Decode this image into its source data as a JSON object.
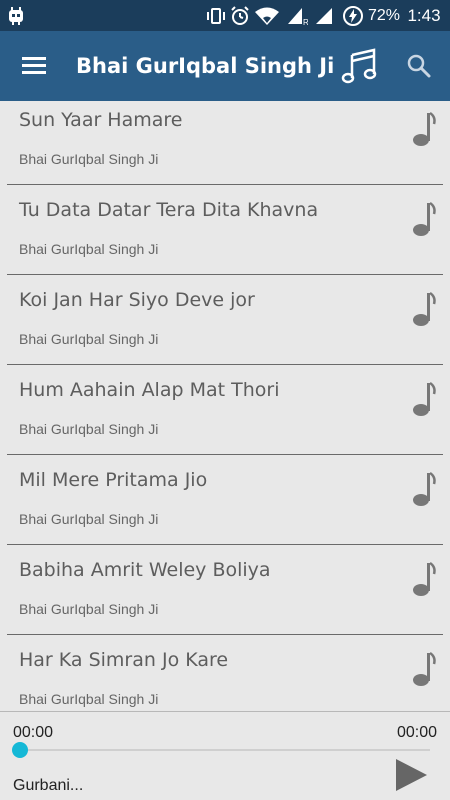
{
  "status_bar": {
    "battery": "72%",
    "time": "1:43",
    "icons": [
      "android-debug-icon",
      "vibrate-icon",
      "alarm-icon",
      "wifi-icon",
      "signal-r-icon",
      "signal-icon",
      "battery-charging-icon"
    ]
  },
  "app_bar": {
    "title": "Bhai GurIqbal Singh Ji",
    "menu_icon": "hamburger-menu-icon",
    "music_icon": "music-notes-icon",
    "search_icon": "search-icon",
    "color": "#2a5d88"
  },
  "songs": [
    {
      "title": "Sun Yaar Hamare",
      "artist": "Bhai GurIqbal Singh Ji"
    },
    {
      "title": "Tu Data Datar Tera Dita Khavna",
      "artist": "Bhai GurIqbal Singh Ji"
    },
    {
      "title": "Koi Jan Har Siyo Deve jor",
      "artist": "Bhai GurIqbal Singh Ji"
    },
    {
      "title": "Hum Aahain Alap Mat Thori",
      "artist": "Bhai GurIqbal Singh Ji"
    },
    {
      "title": "Mil Mere Pritama Jio",
      "artist": "Bhai GurIqbal Singh Ji"
    },
    {
      "title": "Babiha Amrit Weley Boliya",
      "artist": "Bhai GurIqbal Singh Ji"
    },
    {
      "title": "Har Ka Simran Jo Kare",
      "artist": "Bhai GurIqbal Singh Ji"
    }
  ],
  "player": {
    "elapsed": "00:00",
    "duration": "00:00",
    "progress": 0,
    "now_playing": "Gurbani...",
    "accent": "#15b8d6"
  }
}
